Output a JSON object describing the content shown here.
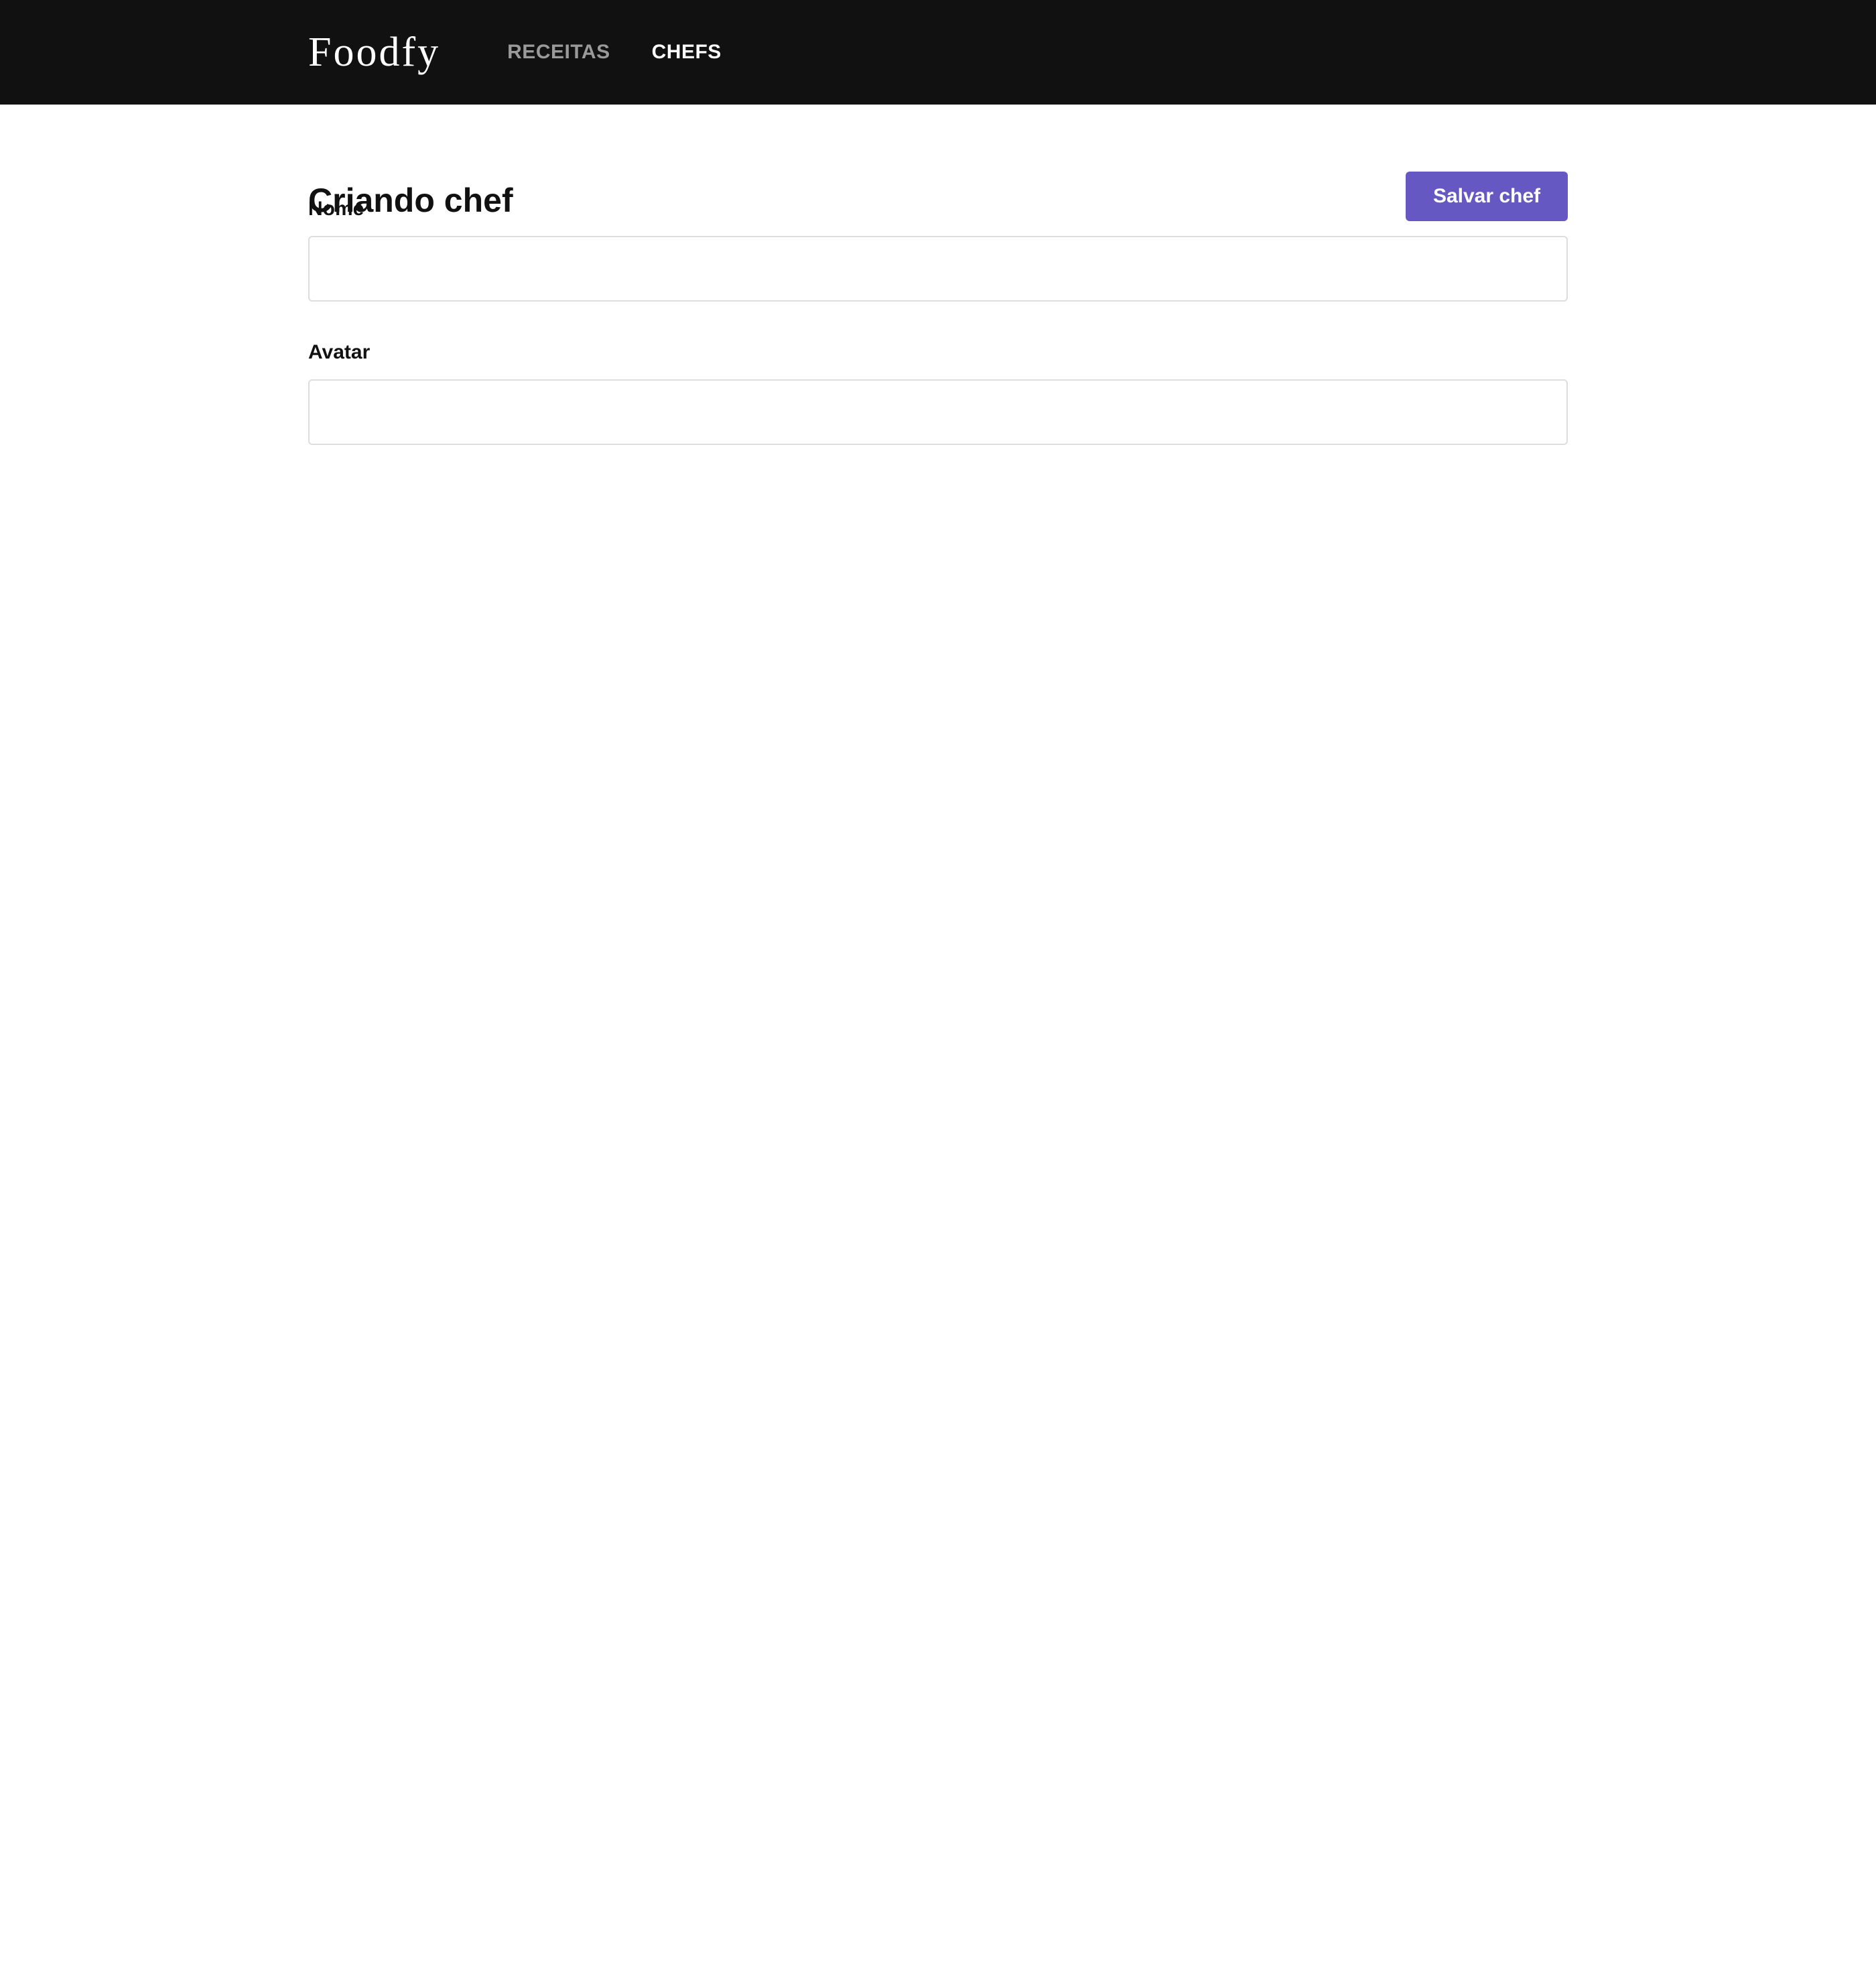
{
  "header": {
    "logo": "Foodfy",
    "nav": [
      {
        "label": "RECEITAS",
        "active": false
      },
      {
        "label": "CHEFS",
        "active": true
      }
    ]
  },
  "page": {
    "title": "Criando chef",
    "save_label": "Salvar chef"
  },
  "form": {
    "nome": {
      "label": "Nome",
      "value": "",
      "placeholder": ""
    },
    "avatar": {
      "label": "Avatar",
      "value": "",
      "placeholder": ""
    }
  },
  "colors": {
    "topbar": "#111111",
    "accent": "#6558c3",
    "nav_inactive": "#9a9a9a",
    "nav_active": "#ffffff"
  }
}
